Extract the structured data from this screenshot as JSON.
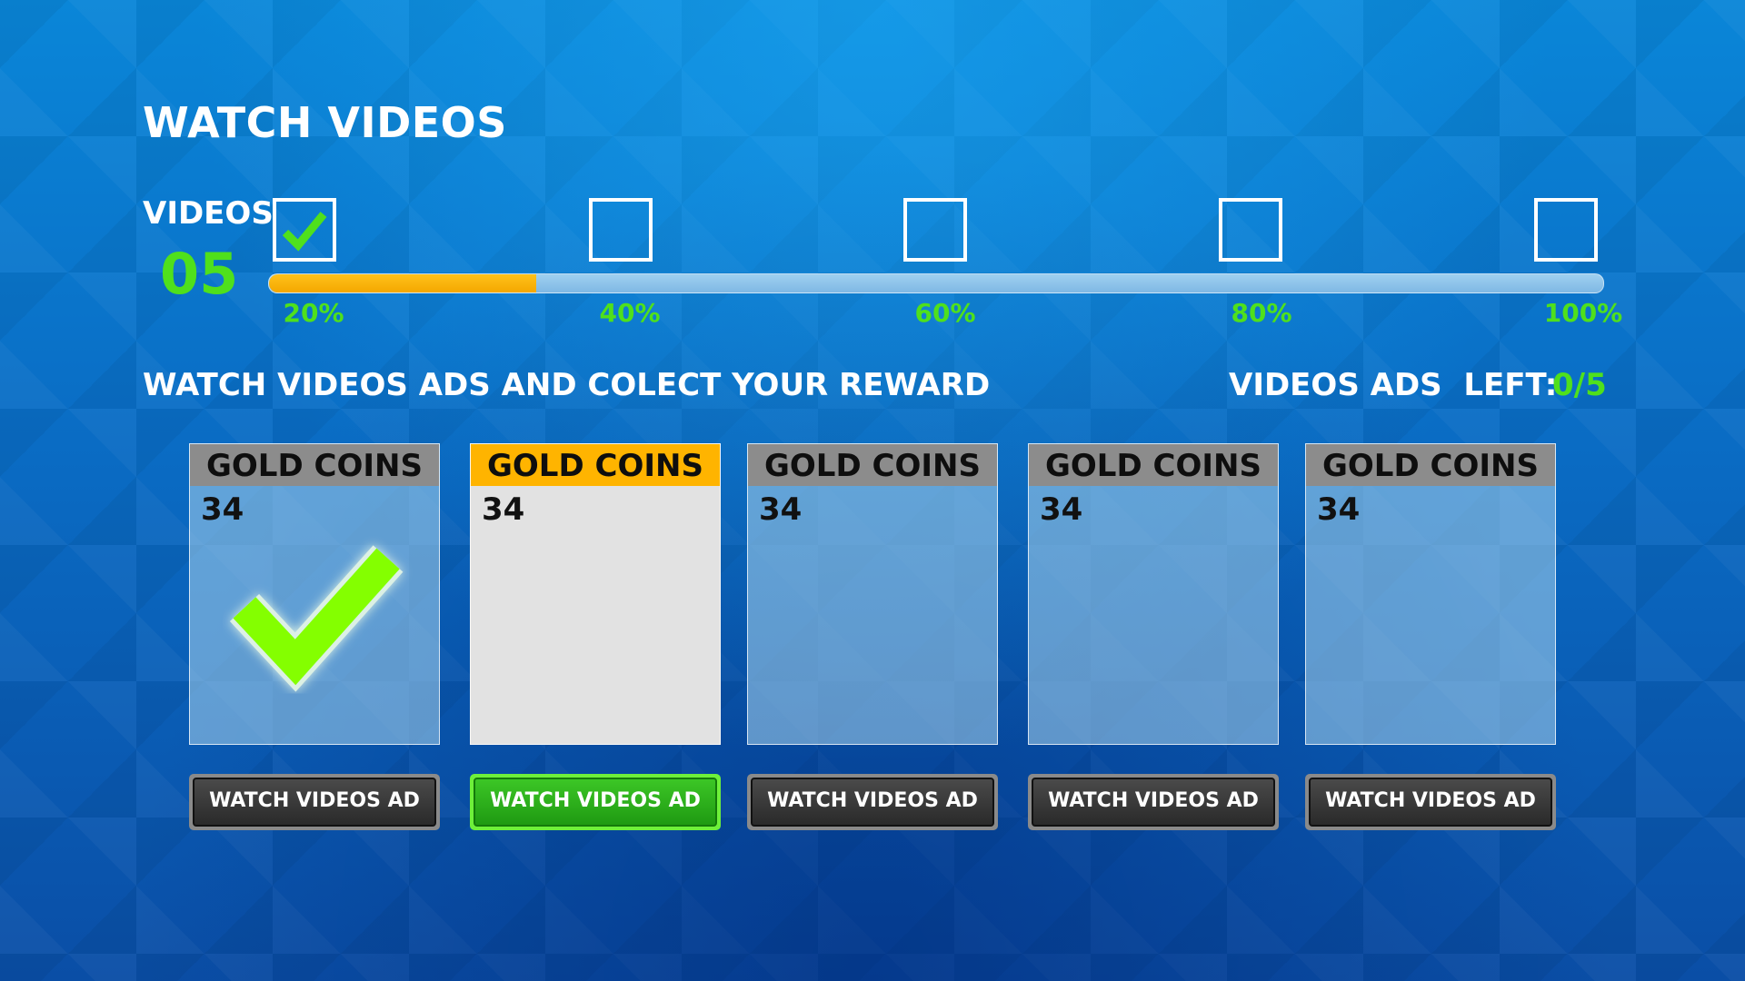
{
  "title": "WATCH VIDEOS",
  "videos_label": "VIDEOS",
  "videos_count": "05",
  "progress": {
    "value_percent": 20
  },
  "milestones": [
    {
      "label": "20%",
      "checked": true
    },
    {
      "label": "40%",
      "checked": false
    },
    {
      "label": "60%",
      "checked": false
    },
    {
      "label": "80%",
      "checked": false
    },
    {
      "label": "100%",
      "checked": false
    }
  ],
  "subtitle": "WATCH VIDEOS ADS AND COLECT YOUR REWARD",
  "ads_left": {
    "label": "VIDEOS ADS  LEFT:",
    "value": "0/5"
  },
  "rewards": [
    {
      "title": "GOLD COINS",
      "value": "34",
      "state": "collected"
    },
    {
      "title": "GOLD COINS",
      "value": "34",
      "state": "active"
    },
    {
      "title": "GOLD COINS",
      "value": "34",
      "state": "locked"
    },
    {
      "title": "GOLD COINS",
      "value": "34",
      "state": "locked"
    },
    {
      "title": "GOLD COINS",
      "value": "34",
      "state": "locked"
    }
  ],
  "buttons": [
    {
      "label": "WATCH VIDEOS AD",
      "active": false
    },
    {
      "label": "WATCH VIDEOS AD",
      "active": true
    },
    {
      "label": "WATCH VIDEOS AD",
      "active": false
    },
    {
      "label": "WATCH VIDEOS AD",
      "active": false
    },
    {
      "label": "WATCH VIDEOS AD",
      "active": false
    }
  ],
  "colors": {
    "accent_green": "#4fe01c",
    "progress_yellow": "#ffc21a",
    "active_header": "#ffb400",
    "background_blue": "#0a6cc4"
  },
  "icons": {
    "milestone_checked": "checkmark-icon",
    "reward_collected": "big-checkmark-icon"
  }
}
